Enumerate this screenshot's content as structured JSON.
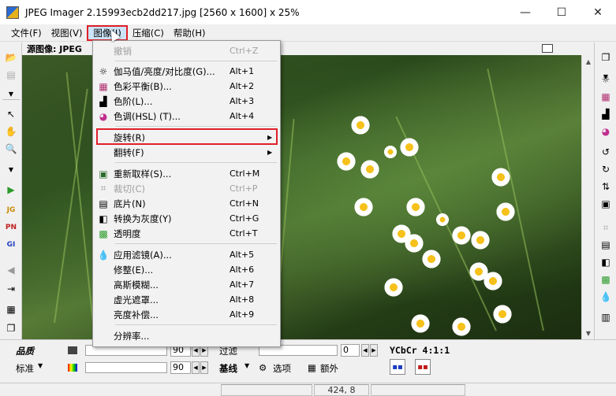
{
  "window": {
    "title": "JPEG Imager 2.15993ecb2dd217.jpg [2560 x 1600] x 25%",
    "controls": [
      "—",
      "☐",
      "✕"
    ]
  },
  "menubar": {
    "items": [
      "文件(F)",
      "视图(V)",
      "图像(I)",
      "压缩(C)",
      "帮助(H)"
    ]
  },
  "source_header": "源图像: JPEG",
  "image_menu": {
    "items": [
      {
        "label": "撤销",
        "shortcut": "Ctrl+Z",
        "disabled": true,
        "icon": ""
      },
      {
        "label": "伽马值/亮度/对比度(G)...",
        "shortcut": "Alt+1",
        "icon": "sun-icon"
      },
      {
        "label": "色彩平衡(B)...",
        "shortcut": "Alt+2",
        "icon": "color-balance-icon"
      },
      {
        "label": "色阶(L)...",
        "shortcut": "Alt+3",
        "icon": "levels-icon"
      },
      {
        "label": "色调(HSL) (T)...",
        "shortcut": "Alt+4",
        "icon": "hue-wheel-icon"
      },
      {
        "label": "旋转(R)",
        "submenu": true,
        "icon": ""
      },
      {
        "label": "翻转(F)",
        "submenu": true,
        "icon": ""
      },
      {
        "label": "重新取样(S)...",
        "shortcut": "Ctrl+M",
        "icon": "resample-icon"
      },
      {
        "label": "裁切(C)",
        "shortcut": "Ctrl+P",
        "disabled": true,
        "icon": "crop-icon"
      },
      {
        "label": "底片(N)",
        "shortcut": "Ctrl+N",
        "icon": "negative-icon"
      },
      {
        "label": "转换为灰度(Y)",
        "shortcut": "Ctrl+G",
        "icon": "grayscale-icon"
      },
      {
        "label": "透明度",
        "shortcut": "Ctrl+T",
        "icon": "transparency-icon"
      },
      {
        "label": "应用滤镜(A)...",
        "shortcut": "Alt+5",
        "icon": "filter-drop-icon"
      },
      {
        "label": "修整(E)...",
        "shortcut": "Alt+6",
        "icon": ""
      },
      {
        "label": "高斯模糊...",
        "shortcut": "Alt+7",
        "icon": ""
      },
      {
        "label": "虚光遮罩...",
        "shortcut": "Alt+8",
        "icon": ""
      },
      {
        "label": "亮度补偿...",
        "shortcut": "Alt+9",
        "icon": ""
      },
      {
        "label": "分辨率...",
        "shortcut": "",
        "icon": ""
      }
    ]
  },
  "bottom_panel": {
    "quality_label": "品质",
    "standard_label": "标准",
    "slider1_value": "90",
    "slider2_value": "90",
    "filter_label": "过滤",
    "filter_value": "0",
    "ycbcr_label": "YCbCr 4:1:1",
    "baseline_label": "基线",
    "options_label": "选项",
    "extra_label": "额外"
  },
  "status_bar": {
    "coords": "424, 8"
  },
  "colors": {
    "highlight": "#e0202a",
    "menu_selected_bg": "#cce4f7"
  }
}
